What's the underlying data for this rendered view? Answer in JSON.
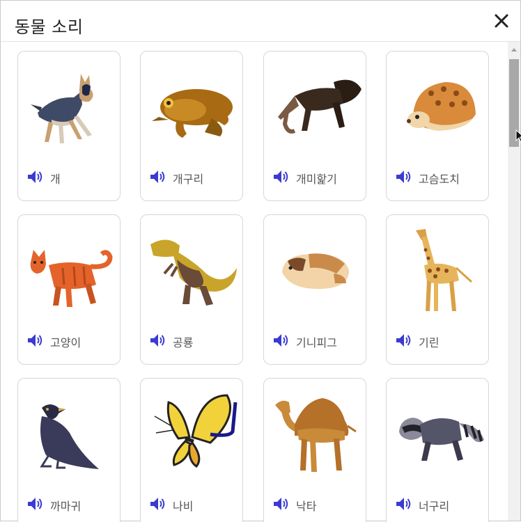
{
  "dialog": {
    "title": "동물 소리"
  },
  "icons": {
    "close": "close-icon",
    "sound": "speaker-icon"
  },
  "colors": {
    "sound_icon": "#3b3bd0",
    "title_text": "#222222",
    "label_text": "#555555"
  },
  "animals": [
    {
      "label": "개",
      "icon": "dog-icon"
    },
    {
      "label": "개구리",
      "icon": "frog-icon"
    },
    {
      "label": "개미핥기",
      "icon": "anteater-icon"
    },
    {
      "label": "고슴도치",
      "icon": "hedgehog-icon"
    },
    {
      "label": "고양이",
      "icon": "cat-icon"
    },
    {
      "label": "공룡",
      "icon": "dinosaur-icon"
    },
    {
      "label": "기니피그",
      "icon": "guinea-pig-icon"
    },
    {
      "label": "기린",
      "icon": "giraffe-icon"
    },
    {
      "label": "까마귀",
      "icon": "crow-icon"
    },
    {
      "label": "나비",
      "icon": "butterfly-icon"
    },
    {
      "label": "낙타",
      "icon": "camel-icon"
    },
    {
      "label": "너구리",
      "icon": "raccoon-icon"
    }
  ]
}
